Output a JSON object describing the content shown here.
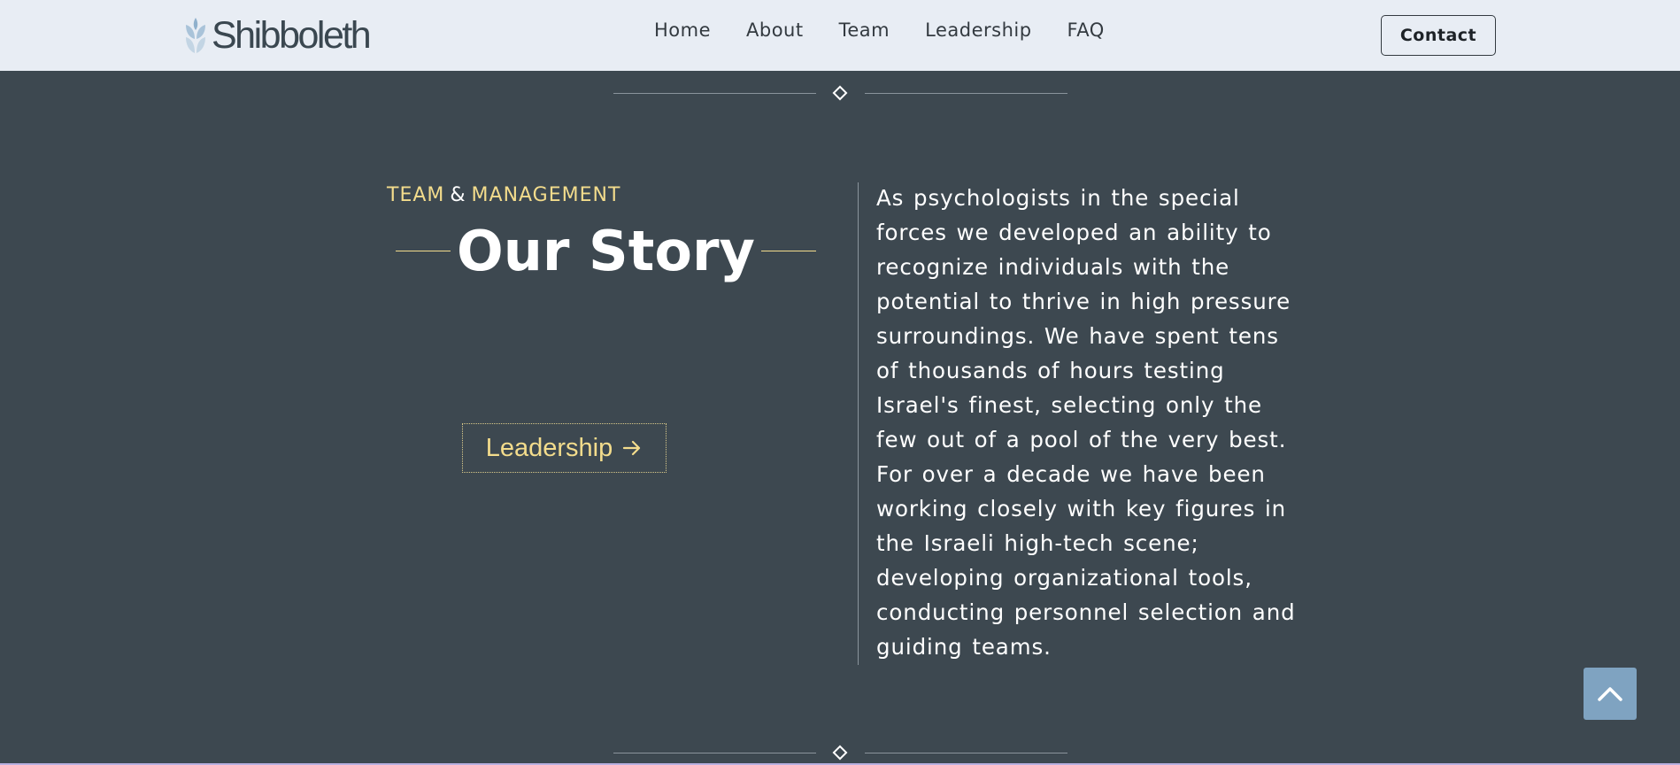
{
  "header": {
    "logo_text": "Shibboleth",
    "nav": [
      "Home",
      "About",
      "Team",
      "Leadership",
      "FAQ"
    ],
    "contact_label": "Contact"
  },
  "section": {
    "kicker_left": "TEAM",
    "kicker_amp": "&",
    "kicker_right": "MANAGEMENT",
    "title": "Our Story",
    "cta_label": "Leadership",
    "story_lines": [
      "As psychologists in the special",
      "forces we developed an ability to",
      "recognize individuals with the",
      "potential to thrive in high pressure",
      "surroundings. We have spent tens",
      "of thousands of hours testing",
      "Israel's finest, selecting only the",
      "few out of a pool of the very best.",
      "For over a decade we have been",
      "working closely with key figures in",
      "the Israeli high-tech scene;",
      "developing organizational tools,",
      "conducting personnel selection and",
      "guiding teams."
    ]
  },
  "colors": {
    "background": "#3d4850",
    "header_bg": "#e8edf4",
    "accent_yellow": "#f3dc8c",
    "top_button": "#7fa3c1"
  },
  "icons": {
    "logo": "wheat-leaf-icon",
    "cta_arrow": "arrow-right-icon",
    "back_to_top": "chevron-up-icon",
    "divider": "diamond-icon"
  }
}
